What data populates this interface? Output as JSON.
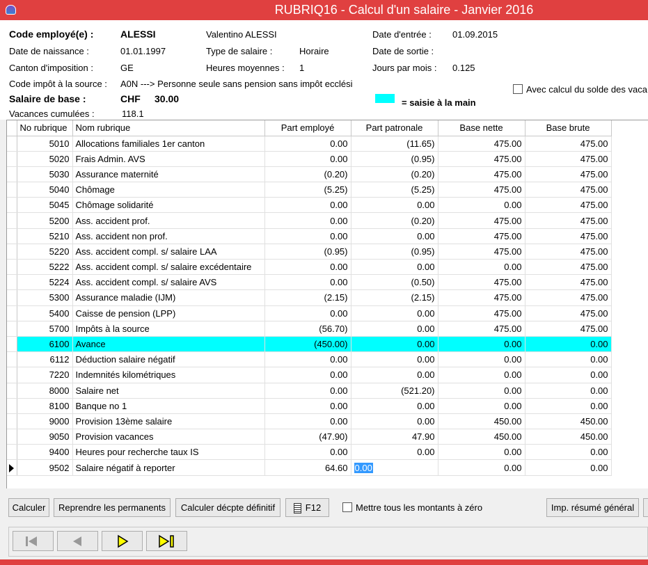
{
  "window": {
    "title": "RUBRIQ16 - Calcul d'un salaire - Janvier 2016"
  },
  "employee": {
    "code_label": "Code employé(e) :",
    "code": "ALESSI",
    "name": "Valentino ALESSI",
    "entry_label": "Date d'entrée :",
    "entry": "01.09.2015",
    "birth_label": "Date de naissance :",
    "birth": "01.01.1997",
    "salary_type_label": "Type de salaire :",
    "salary_type": "Horaire",
    "exit_label": "Date de sortie :",
    "exit": "",
    "canton_label": "Canton d'imposition :",
    "canton": "GE",
    "hours_label": "Heures moyennes :",
    "hours": "1",
    "days_label": "Jours par mois :",
    "days": "0.125",
    "tax_code_label": "Code impôt à la source :",
    "tax_code": "A0N ---> Personne seule sans pension sans impôt ecclési",
    "base_label": "Salaire de base :",
    "base_currency": "CHF",
    "base_amount": "30.00",
    "vacation_label": "Vacances cumulées :",
    "vacation": "118.1",
    "legend": "= saisie à la main",
    "vac_balance_label": "Avec calcul du solde des vaca"
  },
  "colors": {
    "highlight": "#00ffff",
    "title_bar": "#e04040",
    "selection": "#3399ff"
  },
  "grid": {
    "headers": [
      "No rubrique",
      "Nom rubrique",
      "Part employé",
      "Part patronale",
      "Base nette",
      "Base brute"
    ],
    "rows": [
      {
        "code": "5010",
        "name": "Allocations familiales 1er canton",
        "emp": "0.00",
        "pat": "(11.65)",
        "net": "475.00",
        "gross": "475.00"
      },
      {
        "code": "5020",
        "name": "Frais Admin. AVS",
        "emp": "0.00",
        "pat": "(0.95)",
        "net": "475.00",
        "gross": "475.00"
      },
      {
        "code": "5030",
        "name": "Assurance maternité",
        "emp": "(0.20)",
        "pat": "(0.20)",
        "net": "475.00",
        "gross": "475.00"
      },
      {
        "code": "5040",
        "name": "Chômage",
        "emp": "(5.25)",
        "pat": "(5.25)",
        "net": "475.00",
        "gross": "475.00"
      },
      {
        "code": "5045",
        "name": "Chômage solidarité",
        "emp": "0.00",
        "pat": "0.00",
        "net": "0.00",
        "gross": "475.00"
      },
      {
        "code": "5200",
        "name": "Ass. accident prof.",
        "emp": "0.00",
        "pat": "(0.20)",
        "net": "475.00",
        "gross": "475.00"
      },
      {
        "code": "5210",
        "name": "Ass. accident non prof.",
        "emp": "0.00",
        "pat": "0.00",
        "net": "475.00",
        "gross": "475.00"
      },
      {
        "code": "5220",
        "name": "Ass. accident compl. s/ salaire LAA",
        "emp": "(0.95)",
        "pat": "(0.95)",
        "net": "475.00",
        "gross": "475.00"
      },
      {
        "code": "5222",
        "name": "Ass. accident compl. s/ salaire excédentaire",
        "emp": "0.00",
        "pat": "0.00",
        "net": "0.00",
        "gross": "475.00"
      },
      {
        "code": "5224",
        "name": "Ass. accident compl. s/ salaire AVS",
        "emp": "0.00",
        "pat": "(0.50)",
        "net": "475.00",
        "gross": "475.00"
      },
      {
        "code": "5300",
        "name": "Assurance maladie (IJM)",
        "emp": "(2.15)",
        "pat": "(2.15)",
        "net": "475.00",
        "gross": "475.00"
      },
      {
        "code": "5400",
        "name": "Caisse de pension (LPP)",
        "emp": "0.00",
        "pat": "0.00",
        "net": "475.00",
        "gross": "475.00"
      },
      {
        "code": "5700",
        "name": "Impôts à la source",
        "emp": "(56.70)",
        "pat": "0.00",
        "net": "475.00",
        "gross": "475.00"
      },
      {
        "code": "6100",
        "name": "Avance",
        "emp": "(450.00)",
        "pat": "0.00",
        "net": "0.00",
        "gross": "0.00",
        "highlight": true
      },
      {
        "code": "6112",
        "name": "Déduction salaire négatif",
        "emp": "0.00",
        "pat": "0.00",
        "net": "0.00",
        "gross": "0.00"
      },
      {
        "code": "7220",
        "name": "Indemnités kilométriques",
        "emp": "0.00",
        "pat": "0.00",
        "net": "0.00",
        "gross": "0.00"
      },
      {
        "code": "8000",
        "name": "Salaire net",
        "emp": "0.00",
        "pat": "(521.20)",
        "net": "0.00",
        "gross": "0.00"
      },
      {
        "code": "8100",
        "name": "Banque no 1",
        "emp": "0.00",
        "pat": "0.00",
        "net": "0.00",
        "gross": "0.00"
      },
      {
        "code": "9000",
        "name": "Provision 13ème salaire",
        "emp": "0.00",
        "pat": "0.00",
        "net": "450.00",
        "gross": "450.00"
      },
      {
        "code": "9050",
        "name": "Provision vacances",
        "emp": "(47.90)",
        "pat": "47.90",
        "net": "450.00",
        "gross": "450.00"
      },
      {
        "code": "9400",
        "name": "Heures pour recherche taux IS",
        "emp": "0.00",
        "pat": "0.00",
        "net": "0.00",
        "gross": "0.00"
      },
      {
        "code": "9502",
        "name": "Salaire négatif à reporter",
        "emp": "64.60",
        "pat": "0.00",
        "net": "0.00",
        "gross": "0.00",
        "current": true
      }
    ]
  },
  "buttons": {
    "calculer": "Calculer",
    "reprendre": "Reprendre les permanents",
    "decompte": "Calculer décpte définitif",
    "f12": "F12",
    "zero": "Mettre tous les montants à zéro",
    "resume": "Imp. résumé général"
  },
  "nav": [
    "first-record-icon",
    "previous-record-icon",
    "next-record-icon",
    "last-record-icon"
  ]
}
